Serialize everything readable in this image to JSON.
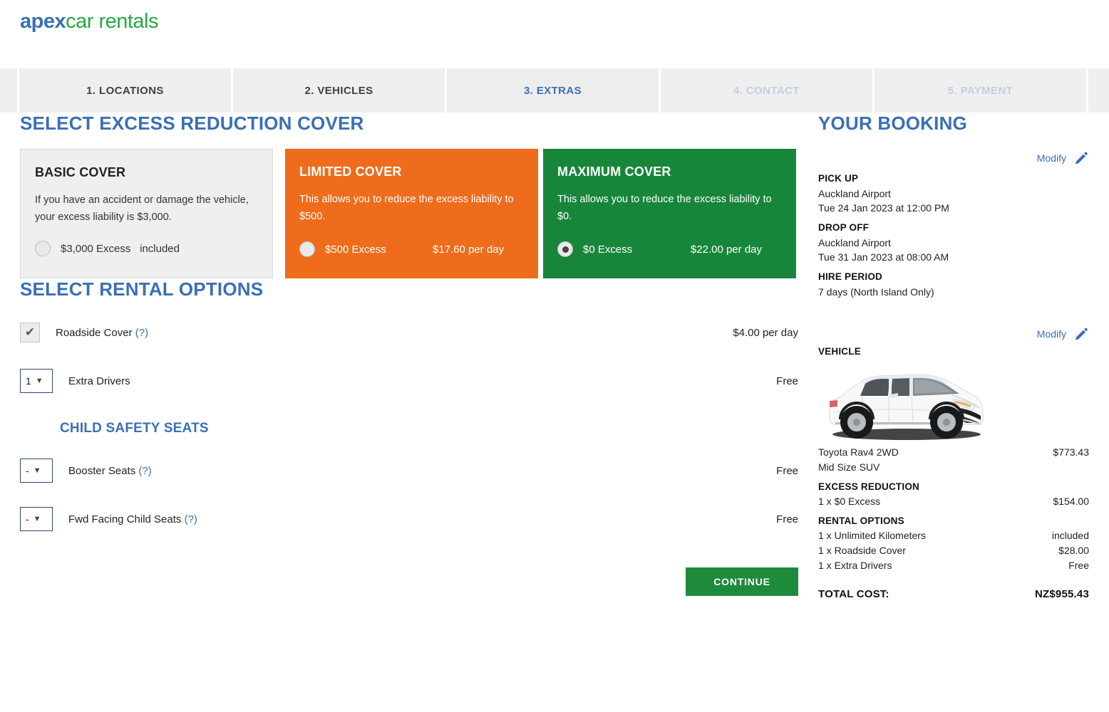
{
  "brand": {
    "part1": "apex",
    "part2": "car rentals",
    "color_blue": "#3a6fb5",
    "color_green": "#28a745"
  },
  "steps": [
    {
      "label": "1. LOCATIONS",
      "state": "done"
    },
    {
      "label": "2. VEHICLES",
      "state": "done"
    },
    {
      "label": "3. EXTRAS",
      "state": "active"
    },
    {
      "label": "4. CONTACT",
      "state": "future"
    },
    {
      "label": "5. PAYMENT",
      "state": "future"
    }
  ],
  "excess_section": {
    "title": "SELECT EXCESS REDUCTION COVER",
    "cards": [
      {
        "title": "BASIC COVER",
        "description": "If you have an accident or damage the vehicle, your excess liability is $3,000.",
        "excess_label": "$3,000 Excess",
        "price": "included",
        "selected": false,
        "color": "#efefef"
      },
      {
        "title": "LIMITED COVER",
        "description": "This allows you to reduce the excess liability to $500.",
        "excess_label": "$500 Excess",
        "price": "$17.60 per day",
        "selected": false,
        "color": "#ef6c1c"
      },
      {
        "title": "MAXIMUM COVER",
        "description": "This allows you to reduce the excess liability to $0.",
        "excess_label": "$0 Excess",
        "price": "$22.00 per day",
        "selected": true,
        "color": "#17863b"
      }
    ]
  },
  "rental_section": {
    "title": "SELECT RENTAL OPTIONS",
    "child_seats_heading": "CHILD SAFETY SEATS",
    "roadside": {
      "label": "Roadside Cover",
      "help": "(?)",
      "price": "$4.00 per day",
      "checked": true,
      "check_glyph": "✔"
    },
    "extra_drivers": {
      "value": "1",
      "label": "Extra Drivers",
      "price": "Free"
    },
    "booster_seats": {
      "value": "-",
      "label": "Booster Seats",
      "help": "(?)",
      "price": "Free"
    },
    "fwd_child_seats": {
      "value": "-",
      "label": "Fwd Facing Child Seats",
      "help": "(?)",
      "price": "Free"
    },
    "continue_label": "CONTINUE",
    "continue_color": "#1e8a3c"
  },
  "booking": {
    "title": "YOUR BOOKING",
    "modify_label": "Modify",
    "modify_icon": "pencil-icon",
    "pickup": {
      "label": "PICK UP",
      "location": "Auckland Airport",
      "datetime": "Tue 24 Jan 2023 at 12:00 PM"
    },
    "dropoff": {
      "label": "DROP OFF",
      "location": "Auckland Airport",
      "datetime": "Tue 31 Jan 2023 at 08:00 AM"
    },
    "hire_period": {
      "label": "HIRE PERIOD",
      "value": "7 days (North Island Only)"
    },
    "vehicle": {
      "label": "VEHICLE",
      "image_alt": "white-toyota-rav4-suv",
      "name": "Toyota Rav4 2WD",
      "class": "Mid Size SUV",
      "price": "$773.43"
    },
    "excess_reduction": {
      "label": "EXCESS REDUCTION",
      "items": [
        {
          "name": "1 x $0 Excess",
          "price": "$154.00"
        }
      ]
    },
    "rental_options": {
      "label": "RENTAL OPTIONS",
      "items": [
        {
          "name": "1 x Unlimited Kilometers",
          "price": "included"
        },
        {
          "name": "1 x Roadside Cover",
          "price": "$28.00"
        },
        {
          "name": "1 x Extra Drivers",
          "price": "Free"
        }
      ]
    },
    "total": {
      "label": "TOTAL COST:",
      "value": "NZ$955.43"
    }
  }
}
